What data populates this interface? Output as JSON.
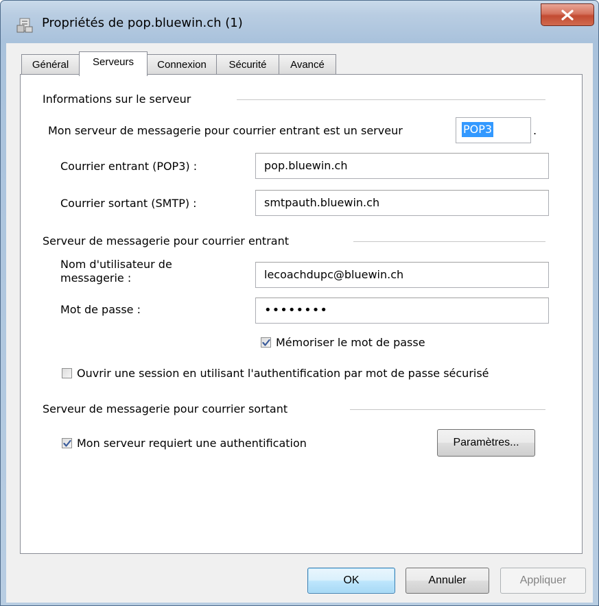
{
  "window": {
    "title": "Propriétés de pop.bluewin.ch (1)"
  },
  "tabs": [
    {
      "label": "Général"
    },
    {
      "label": "Serveurs"
    },
    {
      "label": "Connexion"
    },
    {
      "label": "Sécurité"
    },
    {
      "label": "Avancé"
    }
  ],
  "active_tab": "Serveurs",
  "server_info": {
    "group_label": "Informations sur le serveur",
    "server_type_label": "Mon serveur de messagerie pour courrier entrant est un serveur",
    "server_type_value": "POP3",
    "server_type_suffix": ".",
    "incoming_label": "Courrier entrant (POP3) :",
    "incoming_value": "pop.bluewin.ch",
    "outgoing_label": "Courrier sortant (SMTP) :",
    "outgoing_value": "smtpauth.bluewin.ch"
  },
  "incoming_server": {
    "group_label": "Serveur de messagerie pour courrier entrant",
    "username_label_line1": "Nom d'utilisateur de",
    "username_label_line2": "messagerie :",
    "username_value": "lecoachdupc@bluewin.ch",
    "password_label": "Mot de passe :",
    "password_value": "••••••••",
    "remember_password_label": "Mémoriser le mot de passe",
    "remember_password_checked": true,
    "spa_label": "Ouvrir une session en utilisant l'authentification par mot de passe sécurisé",
    "spa_checked": false
  },
  "outgoing_server": {
    "group_label": "Serveur de messagerie pour courrier sortant",
    "auth_required_label": "Mon serveur requiert une authentification",
    "auth_required_checked": true,
    "settings_button": "Paramètres..."
  },
  "buttons": {
    "ok": "OK",
    "cancel": "Annuler",
    "apply": "Appliquer"
  },
  "colors": {
    "selection": "#3399ff",
    "close_button": "#c24b32",
    "checkmark": "#3a5b9a"
  },
  "icons": {
    "app": "mail-account-properties-icon",
    "close": "close-icon",
    "check": "checkmark-icon"
  }
}
